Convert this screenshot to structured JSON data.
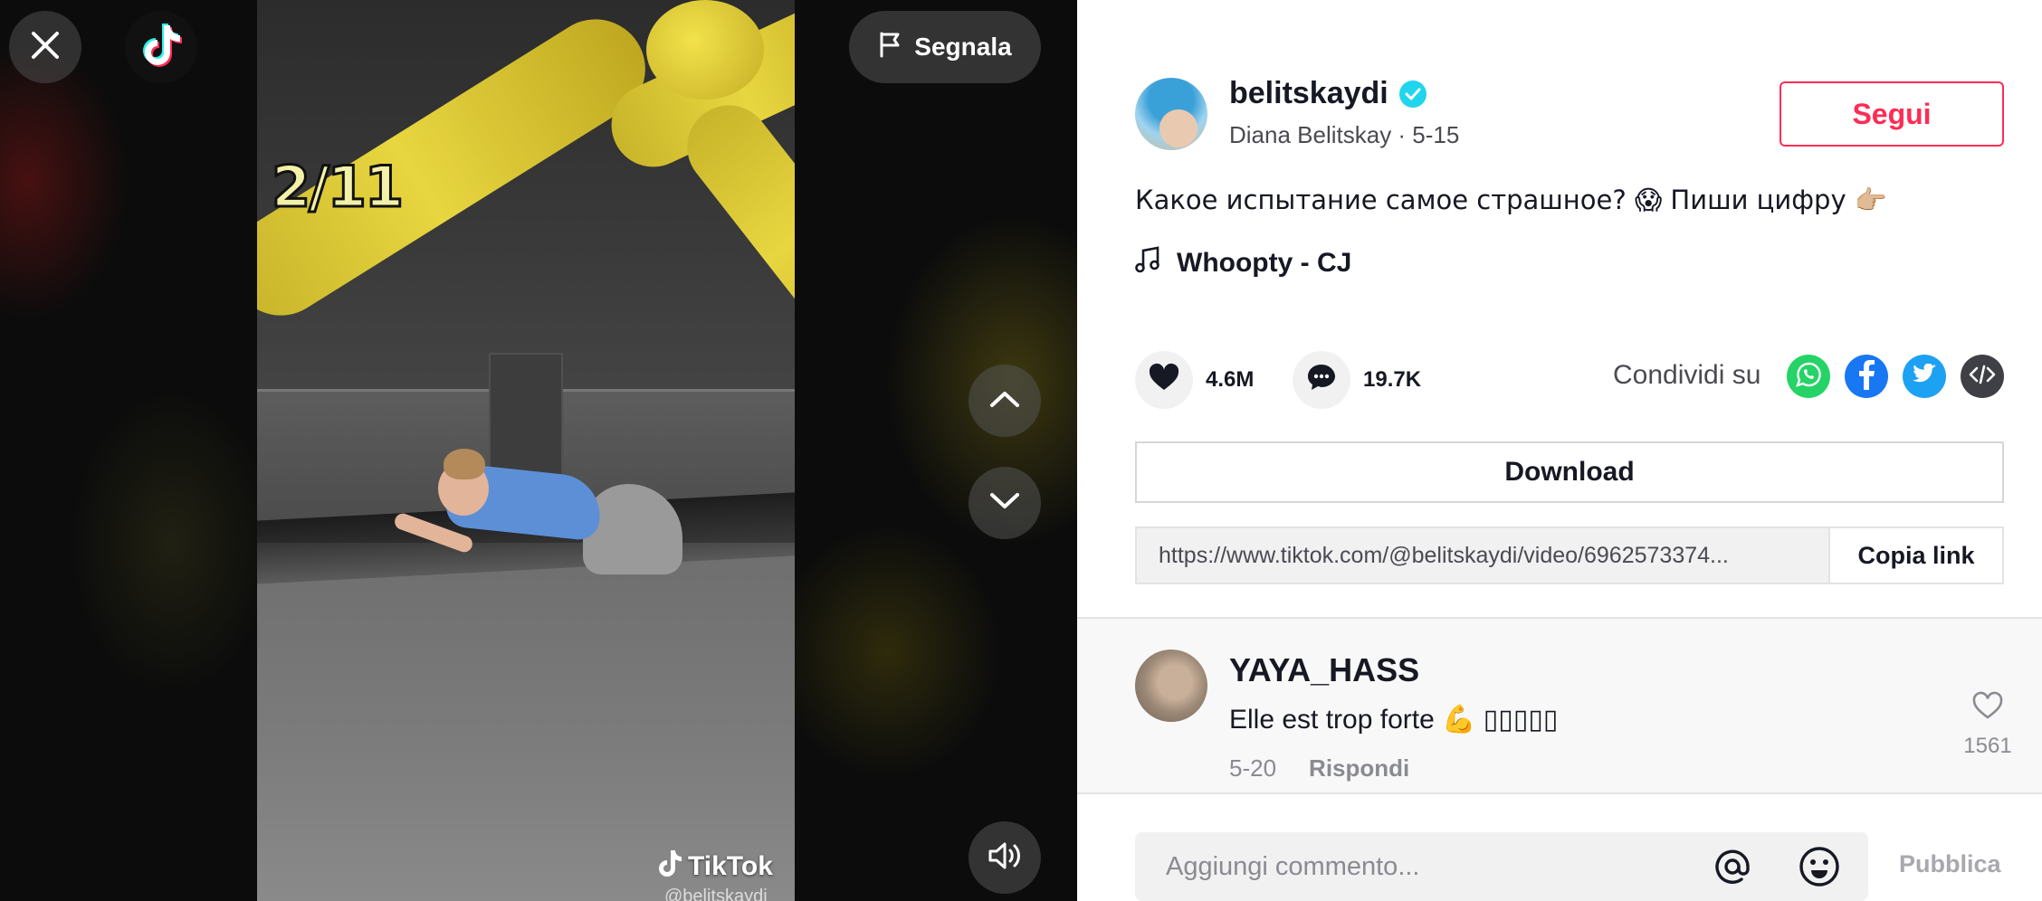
{
  "video": {
    "counter_overlay": "2/11",
    "watermark_brand": "TikTok",
    "watermark_user": "@belitskaydi",
    "report_label": "Segnala"
  },
  "author": {
    "username": "belitskaydi",
    "display_name": "Diana Belitskay",
    "date": "5-15",
    "subline": "Diana Belitskay · 5-15",
    "follow_label": "Segui"
  },
  "post": {
    "caption": "Какое испытание самое страшное? 😱 Пиши цифру 👉🏼",
    "music": "Whoopty - CJ"
  },
  "stats": {
    "likes": "4.6M",
    "comments": "19.7K",
    "share_label": "Condividi su",
    "share_targets": [
      "whatsapp",
      "facebook",
      "twitter",
      "embed"
    ]
  },
  "download_label": "Download",
  "link": {
    "url": "https://www.tiktok.com/@belitskaydi/video/6962573374...",
    "copy_label": "Copia link"
  },
  "comment": {
    "user": "YAYA_HASS",
    "text": "Elle est trop forte 💪 ▯▯▯▯▯",
    "date": "5-20",
    "reply_label": "Rispondi",
    "likes": "1561"
  },
  "composer": {
    "placeholder": "Aggiungi commento...",
    "publish_label": "Pubblica"
  },
  "colors": {
    "accent": "#fe2c55",
    "verified": "#20d5ec",
    "whatsapp": "#25d366",
    "facebook": "#1877f2",
    "twitter": "#1da1f2",
    "embed": "#3f4046"
  }
}
